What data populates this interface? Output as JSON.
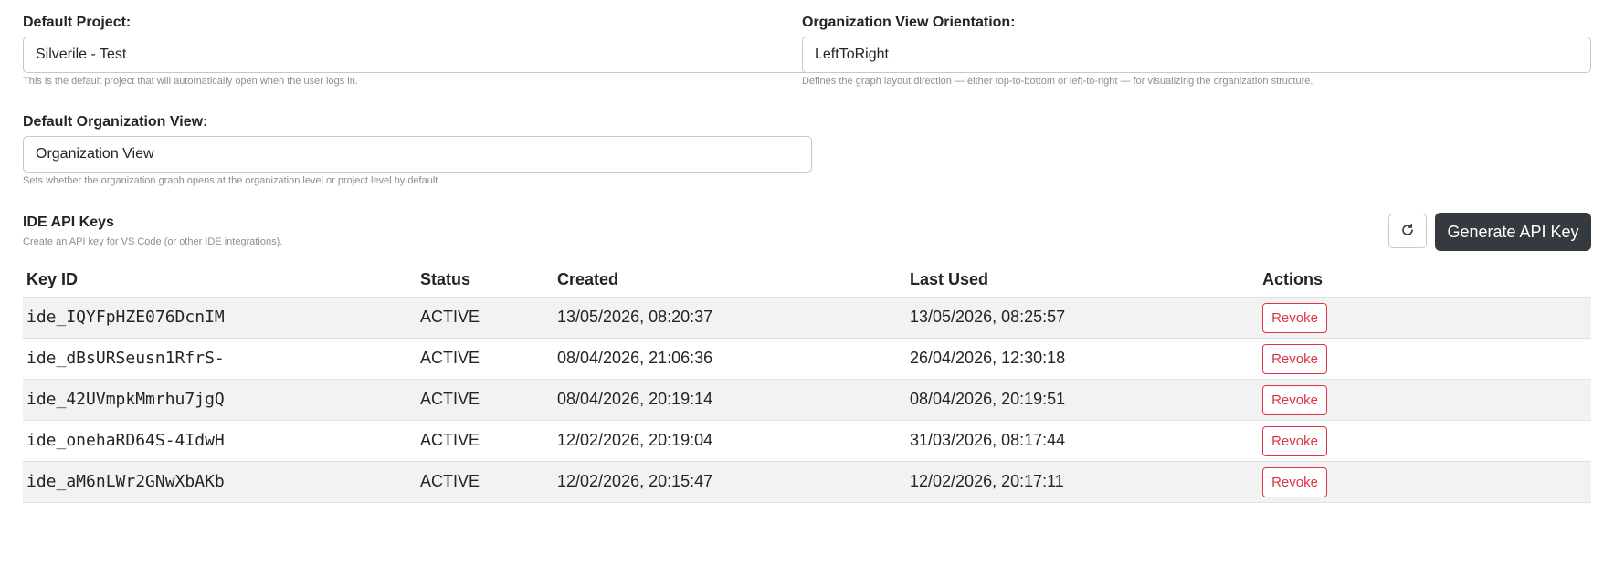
{
  "fields": {
    "default_project": {
      "label": "Default Project:",
      "value": "Silverile - Test",
      "help": "This is the default project that will automatically open when the user logs in."
    },
    "org_view_orientation": {
      "label": "Organization View Orientation:",
      "value": "LeftToRight",
      "help": "Defines the graph layout direction — either top-to-bottom or left-to-right — for visualizing the organization structure."
    },
    "default_org_view": {
      "label": "Default Organization View:",
      "value": "Organization View",
      "help": "Sets whether the organization graph opens at the organization level or project level by default."
    }
  },
  "api_keys": {
    "title": "IDE API Keys",
    "subtitle": "Create an API key for VS Code (or other IDE integrations).",
    "refresh_icon": "refresh-icon",
    "generate_label": "Generate API Key",
    "columns": {
      "key_id": "Key ID",
      "status": "Status",
      "created": "Created",
      "last_used": "Last Used",
      "actions": "Actions"
    },
    "rows": [
      {
        "key_id": "ide_IQYFpHZE076DcnIM",
        "status": "ACTIVE",
        "created": "13/05/2026, 08:20:37",
        "last_used": "13/05/2026, 08:25:57",
        "action": "Revoke"
      },
      {
        "key_id": "ide_dBsURSeusn1RfrS-",
        "status": "ACTIVE",
        "created": "08/04/2026, 21:06:36",
        "last_used": "26/04/2026, 12:30:18",
        "action": "Revoke"
      },
      {
        "key_id": "ide_42UVmpkMmrhu7jgQ",
        "status": "ACTIVE",
        "created": "08/04/2026, 20:19:14",
        "last_used": "08/04/2026, 20:19:51",
        "action": "Revoke"
      },
      {
        "key_id": "ide_onehaRD64S-4IdwH",
        "status": "ACTIVE",
        "created": "12/02/2026, 20:19:04",
        "last_used": "31/03/2026, 08:17:44",
        "action": "Revoke"
      },
      {
        "key_id": "ide_aM6nLWr2GNwXbAKb",
        "status": "ACTIVE",
        "created": "12/02/2026, 20:15:47",
        "last_used": "12/02/2026, 20:17:11",
        "action": "Revoke"
      }
    ]
  },
  "colors": {
    "primary_dark": "#343a40",
    "danger": "#dc3545",
    "help_text": "#8a8f95",
    "stripe": "#f2f2f2"
  }
}
